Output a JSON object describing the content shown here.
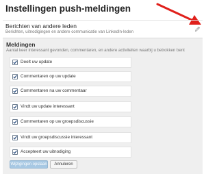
{
  "page": {
    "title": "Instellingen push-meldingen"
  },
  "others_section": {
    "title": "Berichten van andere leden",
    "description": "Berichten, uitnodigingen en andere communicatie van LinkedIn-leden",
    "edit_icon": "pencil-icon"
  },
  "annotation": {
    "arrow_color": "#e0201b"
  },
  "notifications": {
    "title": "Meldingen",
    "description": "Aantal keer interessant gevonden, commentaren, en andere activiteiten waarbij u betrokken bent",
    "options": [
      {
        "label": "Deelt uw update",
        "checked": true
      },
      {
        "label": "Commentaren op uw update",
        "checked": true
      },
      {
        "label": "Commentaren na uw commentaar",
        "checked": true
      },
      {
        "label": "Vindt uw update interessant",
        "checked": true
      },
      {
        "label": "Commentaren op uw groepsdiscussie",
        "checked": true
      },
      {
        "label": "Vindt uw groepsdiscussie interessant",
        "checked": true
      },
      {
        "label": "Accepteert uw uitnodiging",
        "checked": true
      }
    ],
    "save_label": "Wijzigingen opslaan",
    "cancel_label": "Annuleren"
  },
  "colors": {
    "panel_background": "#efefef",
    "save_button": "#a7c8e3",
    "checkmark": "#2c4f80"
  }
}
